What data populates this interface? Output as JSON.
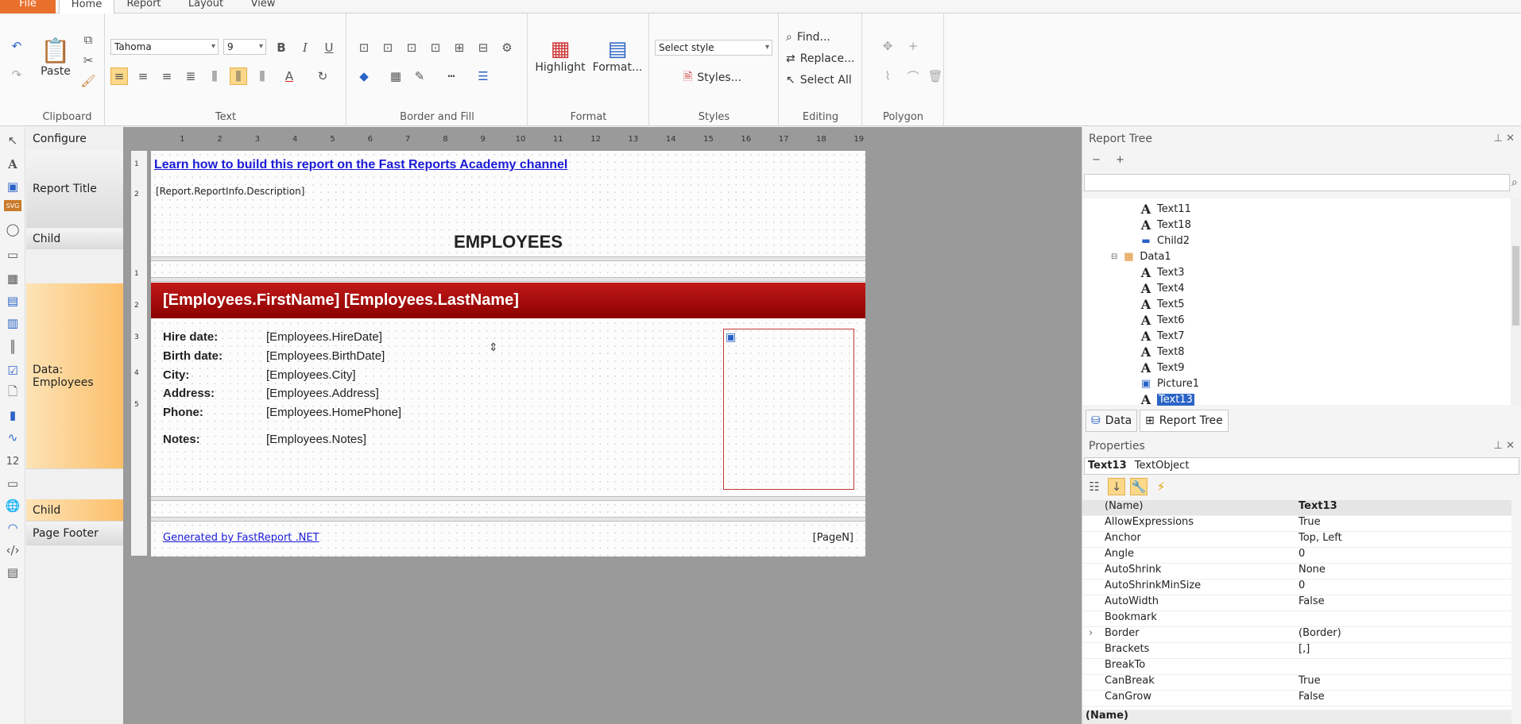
{
  "ribbon_tabs": [
    "File",
    "Home",
    "Report",
    "Layout",
    "View"
  ],
  "clipboard": {
    "paste": "Paste",
    "label": "Clipboard"
  },
  "text_group": {
    "font": "Tahoma",
    "size": "9",
    "label": "Text"
  },
  "border_group": {
    "label": "Border and Fill"
  },
  "format_group": {
    "highlight": "Highlight",
    "format": "Format...",
    "label": "Format"
  },
  "styles_group": {
    "select_style": "Select style",
    "styles": "Styles...",
    "label": "Styles"
  },
  "editing_group": {
    "find": "Find...",
    "replace": "Replace...",
    "select_all": "Select All",
    "label": "Editing"
  },
  "polygon_group": {
    "label": "Polygon"
  },
  "bands": {
    "configure": "Configure",
    "report_title": "Report Title",
    "child1": "Child",
    "data": "Data: Employees",
    "child2": "Child",
    "page_footer": "Page Footer"
  },
  "ruler": [
    "1",
    "2",
    "3",
    "4",
    "5",
    "6",
    "7",
    "8",
    "9",
    "10",
    "11",
    "12",
    "13",
    "14",
    "15",
    "16",
    "17",
    "18",
    "19"
  ],
  "vruler": [
    "1",
    "2",
    "1",
    "2",
    "3",
    "4",
    "5"
  ],
  "report": {
    "link": "Learn how to build this report on the Fast Reports Academy channel",
    "description": "[Report.ReportInfo.Description]",
    "title": "EMPLOYEES",
    "data_header": "[Employees.FirstName] [Employees.LastName]",
    "fields": [
      {
        "label": "Hire date:",
        "value": "[Employees.HireDate]"
      },
      {
        "label": "Birth date:",
        "value": "[Employees.BirthDate]"
      },
      {
        "label": "City:",
        "value": "[Employees.City]"
      },
      {
        "label": "Address:",
        "value": "[Employees.Address]"
      },
      {
        "label": "Phone:",
        "value": "[Employees.HomePhone]"
      },
      {
        "label": "Notes:",
        "value": "[Employees.Notes]"
      }
    ],
    "footer_link": "Generated by FastReport .NET",
    "page_number": "[PageN]"
  },
  "report_tree": {
    "title": "Report Tree",
    "items": [
      "Text11",
      "Text18",
      "Child2",
      "Data1",
      "Text3",
      "Text4",
      "Text5",
      "Text6",
      "Text7",
      "Text8",
      "Text9",
      "Picture1",
      "Text13"
    ],
    "tabs": [
      "Data",
      "Report Tree"
    ]
  },
  "properties": {
    "title": "Properties",
    "object_name": "Text13",
    "object_type": "TextObject",
    "rows": [
      {
        "name": "(Name)",
        "value": "Text13"
      },
      {
        "name": "AllowExpressions",
        "value": "True"
      },
      {
        "name": "Anchor",
        "value": "Top, Left"
      },
      {
        "name": "Angle",
        "value": "0"
      },
      {
        "name": "AutoShrink",
        "value": "None"
      },
      {
        "name": "AutoShrinkMinSize",
        "value": "0"
      },
      {
        "name": "AutoWidth",
        "value": "False"
      },
      {
        "name": "Bookmark",
        "value": ""
      },
      {
        "name": "Border",
        "value": "(Border)"
      },
      {
        "name": "Brackets",
        "value": "[,]"
      },
      {
        "name": "BreakTo",
        "value": ""
      },
      {
        "name": "CanBreak",
        "value": "True"
      },
      {
        "name": "CanGrow",
        "value": "False"
      }
    ],
    "footer": "(Name)"
  }
}
